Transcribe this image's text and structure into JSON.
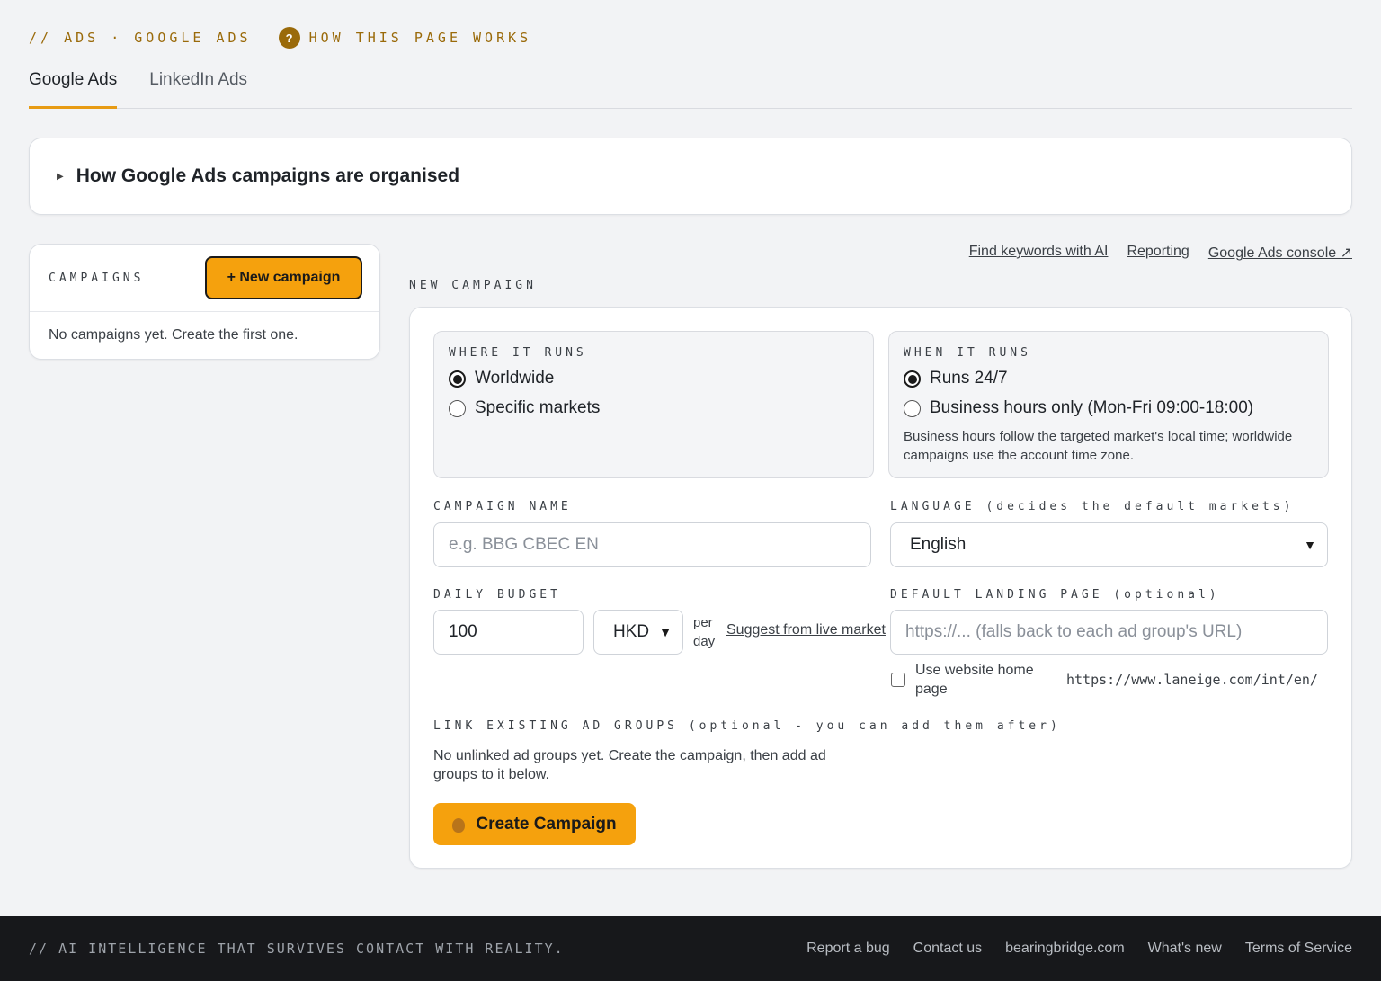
{
  "header": {
    "breadcrumb": "// ADS · GOOGLE ADS",
    "help_label": "HOW THIS PAGE WORKS",
    "help_icon": "?"
  },
  "tabs": [
    {
      "label": "Google Ads",
      "active": true
    },
    {
      "label": "LinkedIn Ads",
      "active": false
    }
  ],
  "accordion": {
    "title": "How Google Ads campaigns are organised"
  },
  "campaigns": {
    "label": "CAMPAIGNS",
    "new_button": "+ New campaign",
    "empty_text": "No campaigns yet. Create the first one."
  },
  "links": {
    "keywords": "Find keywords with AI",
    "reporting": "Reporting",
    "console": "Google Ads console ↗"
  },
  "form": {
    "section_label": "NEW CAMPAIGN",
    "where": {
      "label": "WHERE IT RUNS",
      "options": [
        "Worldwide",
        "Specific markets"
      ],
      "selected": "Worldwide"
    },
    "when": {
      "label": "WHEN IT RUNS",
      "options": [
        "Runs 24/7",
        "Business hours only (Mon-Fri 09:00-18:00)"
      ],
      "selected": "Runs 24/7",
      "note": "Business hours follow the targeted market's local time; worldwide campaigns use the account time zone."
    },
    "campaign_name": {
      "label": "CAMPAIGN NAME",
      "placeholder": "e.g. BBG CBEC EN",
      "value": ""
    },
    "language": {
      "label": "LANGUAGE (decides the default markets)",
      "value": "English"
    },
    "budget": {
      "label": "DAILY BUDGET",
      "value": "100",
      "currency": "HKD",
      "per_day": "per day",
      "suggest": "Suggest from live market"
    },
    "landing": {
      "label": "DEFAULT LANDING PAGE (optional)",
      "placeholder": "https://... (falls back to each ad group's URL)",
      "checkbox_label": "Use website home page",
      "home_url": "https://www.laneige.com/int/en/"
    },
    "link_groups": {
      "label": "LINK EXISTING AD GROUPS (optional - you can add them after)",
      "text": "No unlinked ad groups yet. Create the campaign, then add ad groups to it below."
    },
    "create_button": "Create Campaign"
  },
  "footer": {
    "tagline": "// AI INTELLIGENCE THAT SURVIVES CONTACT WITH REALITY.",
    "links": [
      "Report a bug",
      "Contact us",
      "bearingbridge.com",
      "What's new",
      "Terms of Service"
    ]
  },
  "colors": {
    "accent": "#f5a10d",
    "brand_dark": "#9a6a0a",
    "footer_bg": "#17181b"
  }
}
